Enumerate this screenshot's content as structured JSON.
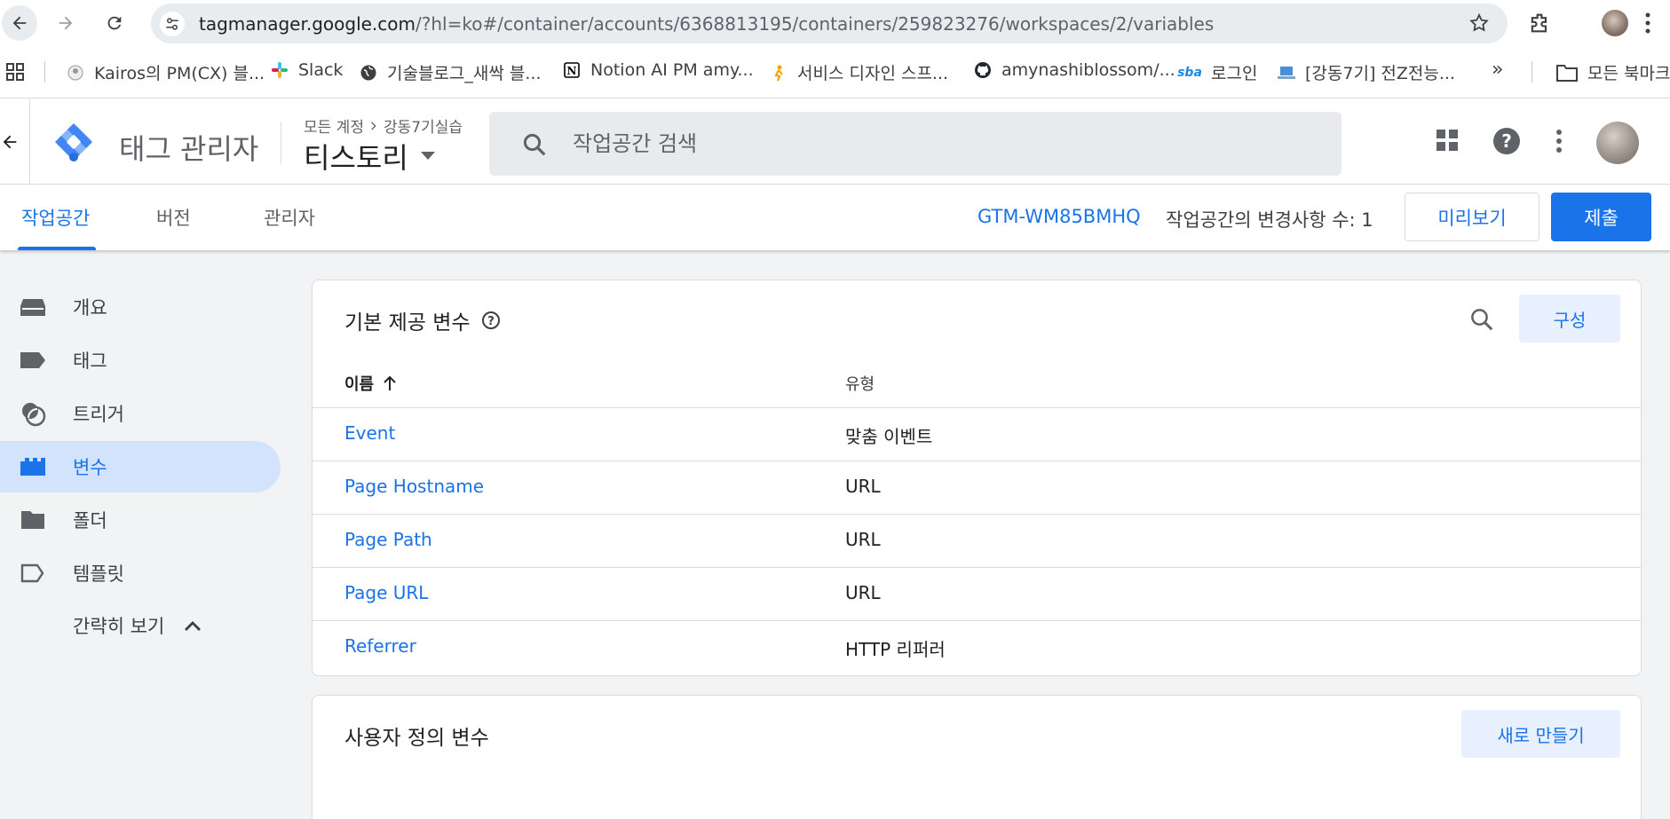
{
  "browser": {
    "url_host": "tagmanager.google.com",
    "url_path": "/?hl=ko#/container/accounts/6368813195/containers/259823276/workspaces/2/variables",
    "bookmarks": [
      {
        "label": "Kairos의 PM(CX) 블...",
        "icon": "kairos-favicon"
      },
      {
        "label": "Slack",
        "icon": "slack-icon"
      },
      {
        "label": "기술블로그_새싹 블...",
        "icon": "globe-icon"
      },
      {
        "label": "Notion AI PM amy...",
        "icon": "notion-icon"
      },
      {
        "label": "서비스 디자인 스프...",
        "icon": "figure-icon"
      },
      {
        "label": "amynashiblossom/...",
        "icon": "github-icon"
      },
      {
        "label": "로그인",
        "icon": "sba-icon"
      },
      {
        "label": "[강동7기] 전Z전능...",
        "icon": "laptop-icon"
      }
    ],
    "bookmarks_more": "»",
    "all_bookmarks": "모든 북마크"
  },
  "header": {
    "product": "태그 관리자",
    "breadcrumb_account": "모든 계정",
    "breadcrumb_container": "강동7기실습",
    "container_name": "티스토리",
    "search_placeholder": "작업공간 검색"
  },
  "tabs": [
    {
      "label": "작업공간",
      "active": true
    },
    {
      "label": "버전",
      "active": false
    },
    {
      "label": "관리자",
      "active": false
    }
  ],
  "toolbar": {
    "container_id": "GTM-WM85BMHQ",
    "changes": "작업공간의 변경사항 수: 1",
    "preview": "미리보기",
    "submit": "제출"
  },
  "sidebar": {
    "items": [
      {
        "label": "개요",
        "icon": "overview-icon"
      },
      {
        "label": "태그",
        "icon": "tag-icon"
      },
      {
        "label": "트리거",
        "icon": "trigger-icon"
      },
      {
        "label": "변수",
        "icon": "variable-icon",
        "active": true
      },
      {
        "label": "폴더",
        "icon": "folder-icon"
      },
      {
        "label": "템플릿",
        "icon": "template-icon"
      }
    ],
    "collapse_label": "간략히 보기"
  },
  "builtin": {
    "title": "기본 제공 변수",
    "configure": "구성",
    "col_name": "이름",
    "col_type": "유형",
    "rows": [
      {
        "name": "Event",
        "type": "맞춤 이벤트"
      },
      {
        "name": "Page Hostname",
        "type": "URL"
      },
      {
        "name": "Page Path",
        "type": "URL"
      },
      {
        "name": "Page URL",
        "type": "URL"
      },
      {
        "name": "Referrer",
        "type": "HTTP 리퍼러"
      }
    ]
  },
  "userdefined": {
    "title": "사용자 정의 변수",
    "new_button": "새로 만들기"
  },
  "colors": {
    "accent": "#1a73e8",
    "active_bg": "#d3e3fd",
    "page_bg": "#f1f3f4"
  }
}
